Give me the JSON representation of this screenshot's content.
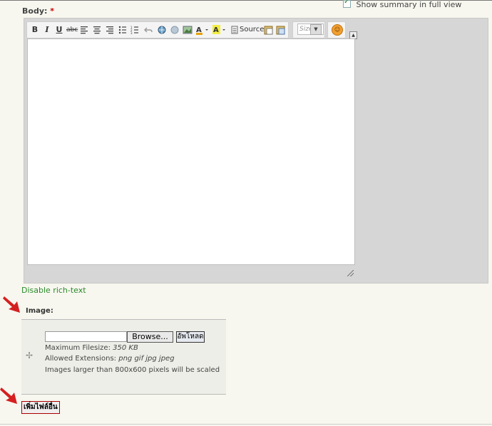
{
  "body_field": {
    "label": "Body:",
    "required_mark": "*",
    "summary_checkbox_label": "Show summary in full view",
    "summary_checked": true
  },
  "toolbar": {
    "bold": "B",
    "italic": "I",
    "underline": "U",
    "strike": "abc",
    "source": "Source",
    "size_placeholder": "Size",
    "icons": [
      "bold-icon",
      "italic-icon",
      "underline-icon",
      "strikethrough-icon",
      "align-left-icon",
      "align-center-icon",
      "align-right-icon",
      "bulleted-list-icon",
      "numbered-list-icon",
      "undo-icon",
      "link-icon",
      "unlink-icon",
      "image-icon",
      "text-color-icon",
      "background-color-icon",
      "source-icon",
      "paste-text-icon",
      "paste-word-icon",
      "smiley-icon"
    ]
  },
  "disable_rich_text": "Disable rich-text",
  "image_field": {
    "label": "Image:",
    "browse_label": "Browse...",
    "upload_label": "อัพโหลด",
    "max_filesize_label": "Maximum Filesize:",
    "max_filesize_value": "350 KB",
    "allowed_ext_label": "Allowed Extensions:",
    "allowed_ext_value": "png gif jpg jpeg",
    "scaling_note": "Images larger than 800x600 pixels will be scaled",
    "add_more_label": "เพิ่มไฟล์อื่น"
  },
  "colors": {
    "accent_green": "#2a8a2a",
    "required_red": "#cc0000",
    "annotation_arrow": "#d42020"
  }
}
